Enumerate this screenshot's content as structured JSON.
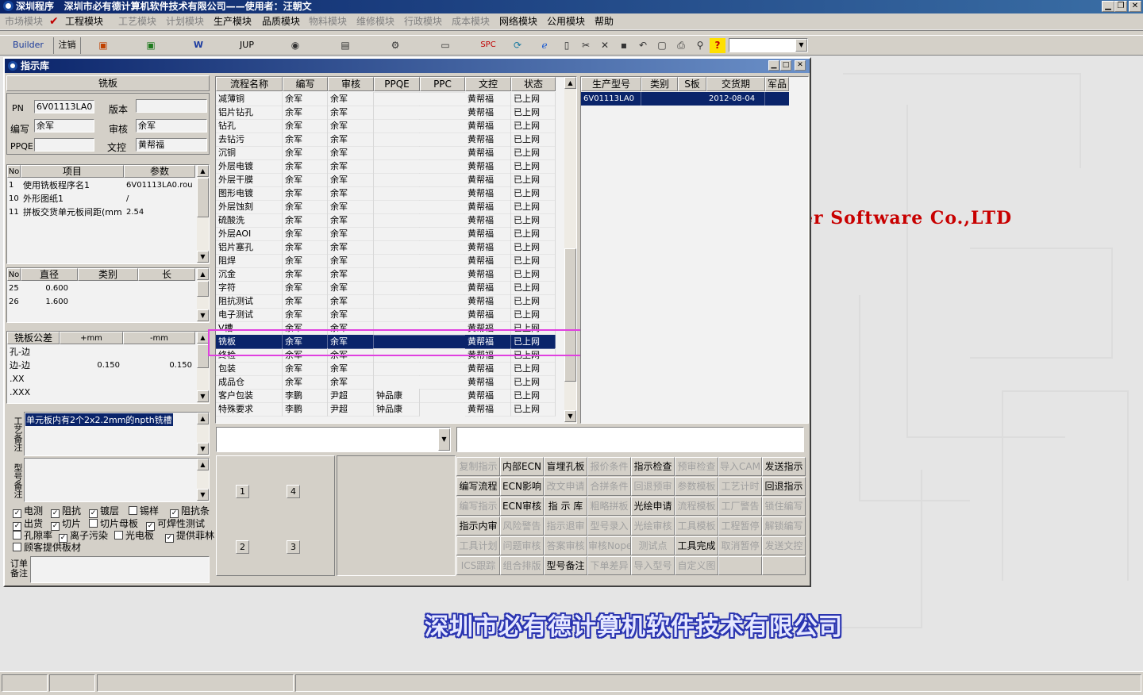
{
  "title_bar": {
    "app": "深圳程序",
    "company": "深圳市必有德计算机软件技术有限公司——使用者：汪朝文"
  },
  "menu": [
    {
      "label": "市场模块",
      "enabled": false
    },
    {
      "label": "工程模块",
      "enabled": true,
      "checked": true
    },
    {
      "label": "工艺模块",
      "enabled": false
    },
    {
      "label": "计划模块",
      "enabled": false
    },
    {
      "label": "生产模块",
      "enabled": true
    },
    {
      "label": "品质模块",
      "enabled": true
    },
    {
      "label": "物料模块",
      "enabled": false
    },
    {
      "label": "维修模块",
      "enabled": false
    },
    {
      "label": "行政模块",
      "enabled": false
    },
    {
      "label": "成本模块",
      "enabled": false
    },
    {
      "label": "网络模块",
      "enabled": true
    },
    {
      "label": "公用模块",
      "enabled": true
    },
    {
      "label": "帮助",
      "enabled": true
    }
  ],
  "toolbar": {
    "builder": "Builder",
    "logout": "注销",
    "jup": "JUP",
    "spc": "SPC",
    "icons": [
      "powerpoint-icon",
      "excel-icon",
      "word-icon",
      "eye-icon",
      "database-icon",
      "network-icon",
      "printer-fax-icon",
      "refresh-icon",
      "ie-globe-icon",
      "new-doc-icon",
      "cut-icon",
      "delete-icon",
      "save-icon",
      "undo-icon",
      "preview-icon",
      "print-icon",
      "find-icon",
      "help-icon"
    ]
  },
  "window": {
    "title": "指示库"
  },
  "board": {
    "header": "铣板",
    "pn_label": "PN",
    "pn": "6V01113LA0",
    "version_label": "版本",
    "version": "",
    "editor_label": "编写",
    "editor": "余军",
    "reviewer_label": "审核",
    "reviewer": "余军",
    "ppqe_label": "PPQE",
    "ppqe": "",
    "doc_label": "文控",
    "doc": "黄帮福"
  },
  "params": {
    "headers": [
      "No",
      "项目",
      "参数"
    ],
    "rows": [
      [
        "1",
        "使用铣板程序名1",
        "6V01113LA0.rou"
      ],
      [
        "10",
        "外形图纸1",
        "/"
      ],
      [
        "11",
        "拼板交货单元板间距(mm",
        "2.54"
      ]
    ]
  },
  "drills": {
    "headers": [
      "No",
      "直径",
      "类别",
      "长"
    ],
    "rows": [
      [
        "25",
        "0.600",
        "",
        ""
      ],
      [
        "26",
        "1.600",
        "",
        ""
      ]
    ]
  },
  "tolerance": {
    "headers": [
      "铣板公差",
      "+mm",
      "-mm"
    ],
    "rows": [
      [
        "孔-边",
        "",
        ""
      ],
      [
        "边-边",
        "0.150",
        "0.150"
      ],
      [
        ".XX",
        "",
        ""
      ],
      [
        ".XXX",
        "",
        ""
      ]
    ]
  },
  "process_note": {
    "label": "工艺备注",
    "text": "单元板内有2个2x2.2mm的npth铣槽"
  },
  "model_note": {
    "label": "型号备注",
    "text": ""
  },
  "checks": [
    {
      "label": "电测",
      "checked": true
    },
    {
      "label": "阻抗",
      "checked": true
    },
    {
      "label": "镀层",
      "checked": true
    },
    {
      "label": "锡样",
      "checked": false
    },
    {
      "label": "阻抗条",
      "checked": true
    },
    {
      "label": "出货",
      "checked": true
    },
    {
      "label": "切片",
      "checked": true
    },
    {
      "label": "切片母板",
      "checked": false
    },
    {
      "label": "可焊性测试",
      "checked": true
    },
    {
      "label": "孔隙率",
      "checked": false
    },
    {
      "label": "离子污染",
      "checked": true
    },
    {
      "label": "光电板",
      "checked": false
    },
    {
      "label": "提供菲林",
      "checked": true
    },
    {
      "label": "顾客提供板材",
      "checked": false
    }
  ],
  "order_note": {
    "label": "订单备注",
    "text": ""
  },
  "process_grid": {
    "headers": [
      "流程名称",
      "编写",
      "审核",
      "PPQE",
      "PPC",
      "文控",
      "状态"
    ],
    "selected_index": 18,
    "rows": [
      [
        "减薄铜",
        "余军",
        "余军",
        "",
        "",
        "黄帮福",
        "已上网"
      ],
      [
        "铝片钻孔",
        "余军",
        "余军",
        "",
        "",
        "黄帮福",
        "已上网"
      ],
      [
        "钻孔",
        "余军",
        "余军",
        "",
        "",
        "黄帮福",
        "已上网"
      ],
      [
        "去钻污",
        "余军",
        "余军",
        "",
        "",
        "黄帮福",
        "已上网"
      ],
      [
        "沉铜",
        "余军",
        "余军",
        "",
        "",
        "黄帮福",
        "已上网"
      ],
      [
        "外层电镀",
        "余军",
        "余军",
        "",
        "",
        "黄帮福",
        "已上网"
      ],
      [
        "外层干膜",
        "余军",
        "余军",
        "",
        "",
        "黄帮福",
        "已上网"
      ],
      [
        "图形电镀",
        "余军",
        "余军",
        "",
        "",
        "黄帮福",
        "已上网"
      ],
      [
        "外层蚀刻",
        "余军",
        "余军",
        "",
        "",
        "黄帮福",
        "已上网"
      ],
      [
        "硫酸洗",
        "余军",
        "余军",
        "",
        "",
        "黄帮福",
        "已上网"
      ],
      [
        "外层AOI",
        "余军",
        "余军",
        "",
        "",
        "黄帮福",
        "已上网"
      ],
      [
        "铝片塞孔",
        "余军",
        "余军",
        "",
        "",
        "黄帮福",
        "已上网"
      ],
      [
        "阻焊",
        "余军",
        "余军",
        "",
        "",
        "黄帮福",
        "已上网"
      ],
      [
        "沉金",
        "余军",
        "余军",
        "",
        "",
        "黄帮福",
        "已上网"
      ],
      [
        "字符",
        "余军",
        "余军",
        "",
        "",
        "黄帮福",
        "已上网"
      ],
      [
        "阻抗测试",
        "余军",
        "余军",
        "",
        "",
        "黄帮福",
        "已上网"
      ],
      [
        "电子测试",
        "余军",
        "余军",
        "",
        "",
        "黄帮福",
        "已上网"
      ],
      [
        "V槽",
        "余军",
        "余军",
        "",
        "",
        "黄帮福",
        "已上网"
      ],
      [
        "铣板",
        "余军",
        "余军",
        "",
        "",
        "黄帮福",
        "已上网"
      ],
      [
        "终检",
        "余军",
        "余军",
        "",
        "",
        "黄帮福",
        "已上网"
      ],
      [
        "包装",
        "余军",
        "余军",
        "",
        "",
        "黄帮福",
        "已上网"
      ],
      [
        "成品仓",
        "余军",
        "余军",
        "",
        "",
        "黄帮福",
        "已上网"
      ],
      [
        "客户包装",
        "李鹏",
        "尹超",
        "钟品康",
        "",
        "黄帮福",
        "已上网"
      ],
      [
        "特殊要求",
        "李鹏",
        "尹超",
        "钟品康",
        "",
        "黄帮福",
        "已上网"
      ]
    ]
  },
  "model_grid": {
    "headers": [
      "生产型号",
      "类别",
      "S板",
      "交货期",
      "军品"
    ],
    "rows": [
      [
        "6V01113LA0",
        "",
        "",
        "2012-08-04",
        ""
      ]
    ]
  },
  "num_buttons": [
    "1",
    "4",
    "2",
    "3"
  ],
  "action_buttons": [
    {
      "label": "复制指示",
      "enabled": false
    },
    {
      "label": "内部ECN",
      "enabled": true
    },
    {
      "label": "盲埋孔板",
      "enabled": true
    },
    {
      "label": "报价条件",
      "enabled": false
    },
    {
      "label": "指示检查",
      "enabled": true
    },
    {
      "label": "预审检查",
      "enabled": false
    },
    {
      "label": "导入CAM",
      "enabled": false
    },
    {
      "label": "发送指示",
      "enabled": true
    },
    {
      "label": "编写流程",
      "enabled": true
    },
    {
      "label": "ECN影响",
      "enabled": true
    },
    {
      "label": "改文申请",
      "enabled": false
    },
    {
      "label": "合拼条件",
      "enabled": false
    },
    {
      "label": "回退预审",
      "enabled": false
    },
    {
      "label": "参数模板",
      "enabled": false
    },
    {
      "label": "工艺计时",
      "enabled": false
    },
    {
      "label": "回退指示",
      "enabled": true
    },
    {
      "label": "编写指示",
      "enabled": false
    },
    {
      "label": "ECN审核",
      "enabled": true
    },
    {
      "label": "指 示 库",
      "enabled": true
    },
    {
      "label": "粗略拼板",
      "enabled": false
    },
    {
      "label": "光绘申请",
      "enabled": true
    },
    {
      "label": "流程模板",
      "enabled": false
    },
    {
      "label": "工厂警告",
      "enabled": false
    },
    {
      "label": "锁住编写",
      "enabled": false
    },
    {
      "label": "指示内审",
      "enabled": true
    },
    {
      "label": "风险警告",
      "enabled": false
    },
    {
      "label": "指示退审",
      "enabled": false
    },
    {
      "label": "型号录入",
      "enabled": false
    },
    {
      "label": "光绘审核",
      "enabled": false
    },
    {
      "label": "工具模板",
      "enabled": false
    },
    {
      "label": "工程暂停",
      "enabled": false
    },
    {
      "label": "解锁编写",
      "enabled": false
    },
    {
      "label": "工具计划",
      "enabled": false
    },
    {
      "label": "问题审核",
      "enabled": false
    },
    {
      "label": "答案审核",
      "enabled": false
    },
    {
      "label": "审核Nope",
      "enabled": false
    },
    {
      "label": "测试点",
      "enabled": false
    },
    {
      "label": "工具完成",
      "enabled": true
    },
    {
      "label": "取消暂停",
      "enabled": false
    },
    {
      "label": "发送文控",
      "enabled": false
    },
    {
      "label": "ICS跟踪",
      "enabled": false
    },
    {
      "label": "组合排版",
      "enabled": false
    },
    {
      "label": "型号备注",
      "enabled": true
    },
    {
      "label": "下单差异",
      "enabled": false
    },
    {
      "label": "导入型号",
      "enabled": false
    },
    {
      "label": "自定义图",
      "enabled": false
    },
    {
      "label": "",
      "enabled": false
    },
    {
      "label": "",
      "enabled": false
    }
  ],
  "background": {
    "text_en": "er Software Co.,LTD",
    "text_cn": "深圳市必有德计算机软件技术有限公司"
  },
  "colors": {
    "title": "#0a246a",
    "selection": "#0a246a",
    "highlight_box": "#e040e0",
    "face": "#d4d0c8",
    "logo_red": "#c80000",
    "logo_blue": "#2a34b0"
  }
}
